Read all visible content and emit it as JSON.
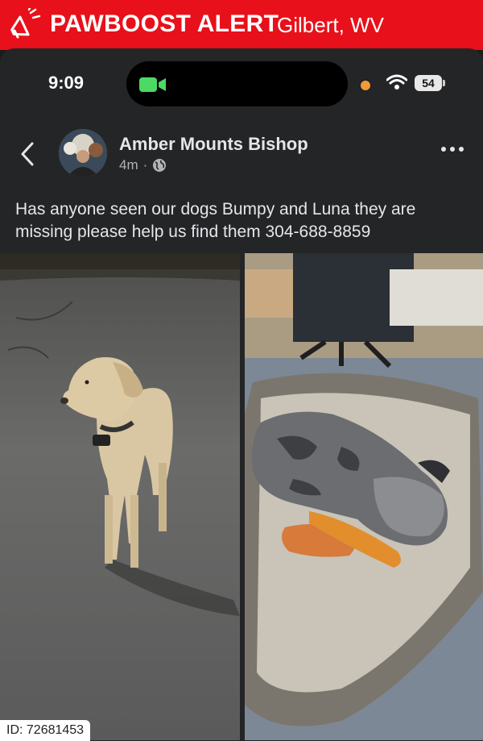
{
  "alert": {
    "brand": "PAWBOOST ALERT",
    "location": "Gilbert, WV",
    "icon": "megaphone-icon",
    "color": "#e8101a"
  },
  "status_bar": {
    "time": "9:09",
    "battery": "54"
  },
  "post": {
    "author": "Amber Mounts Bishop",
    "time_ago": "4m",
    "separator": "·",
    "text": "Has anyone seen our dogs Bumpy and Luna they are missing please help us find them 304-688-8859"
  },
  "footer": {
    "id_label": "ID: 72681453"
  }
}
